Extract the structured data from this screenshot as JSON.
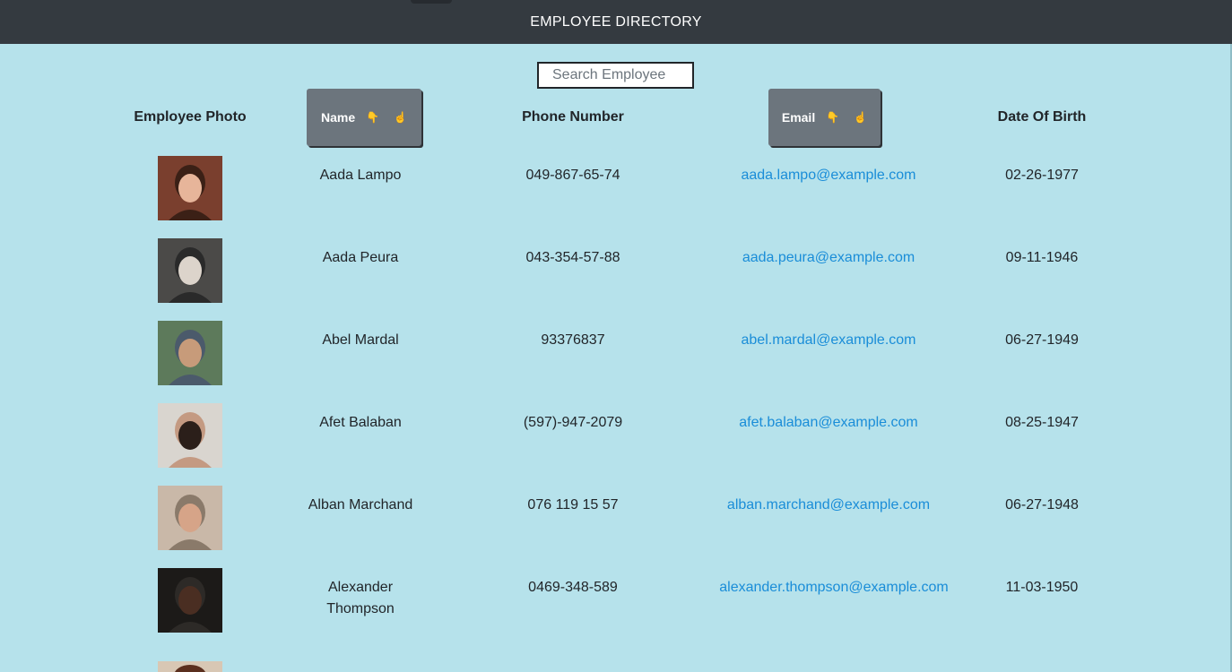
{
  "header": {
    "title": "EMPLOYEE DIRECTORY"
  },
  "search": {
    "placeholder": "Search Employee"
  },
  "table": {
    "columns": {
      "photo": "Employee Photo",
      "name": "Name",
      "phone": "Phone Number",
      "email": "Email",
      "dob": "Date Of Birth"
    },
    "sort_icons": {
      "down": "👇",
      "up": "☝"
    },
    "rows": [
      {
        "name": "Aada Lampo",
        "phone": "049-867-65-74",
        "email": "aada.lampo@example.com",
        "dob": "02-26-1977",
        "photo_colors": [
          "#7a3f2e",
          "#e7b59a",
          "#3b2016"
        ]
      },
      {
        "name": "Aada Peura",
        "phone": "043-354-57-88",
        "email": "aada.peura@example.com",
        "dob": "09-11-1946",
        "photo_colors": [
          "#4b4a48",
          "#dcd4cb",
          "#2a2a2a"
        ]
      },
      {
        "name": "Abel Mardal",
        "phone": "93376837",
        "email": "abel.mardal@example.com",
        "dob": "06-27-1949",
        "photo_colors": [
          "#5d7a5b",
          "#c79b7a",
          "#4b5a6b"
        ]
      },
      {
        "name": "Afet Balaban",
        "phone": "(597)-947-2079",
        "email": "afet.balaban@example.com",
        "dob": "08-25-1947",
        "photo_colors": [
          "#d9d5cf",
          "#2b1f1a",
          "#c49a82"
        ]
      },
      {
        "name": "Alban Marchand",
        "phone": "076 119 15 57",
        "email": "alban.marchand@example.com",
        "dob": "06-27-1948",
        "photo_colors": [
          "#c9b8a8",
          "#d6a488",
          "#8a7a6a"
        ]
      },
      {
        "name": "Alexander Thompson",
        "phone": "0469-348-589",
        "email": "alexander.thompson@example.com",
        "dob": "11-03-1950",
        "photo_colors": [
          "#1c1a18",
          "#4a2e22",
          "#2d2a27"
        ]
      }
    ]
  }
}
